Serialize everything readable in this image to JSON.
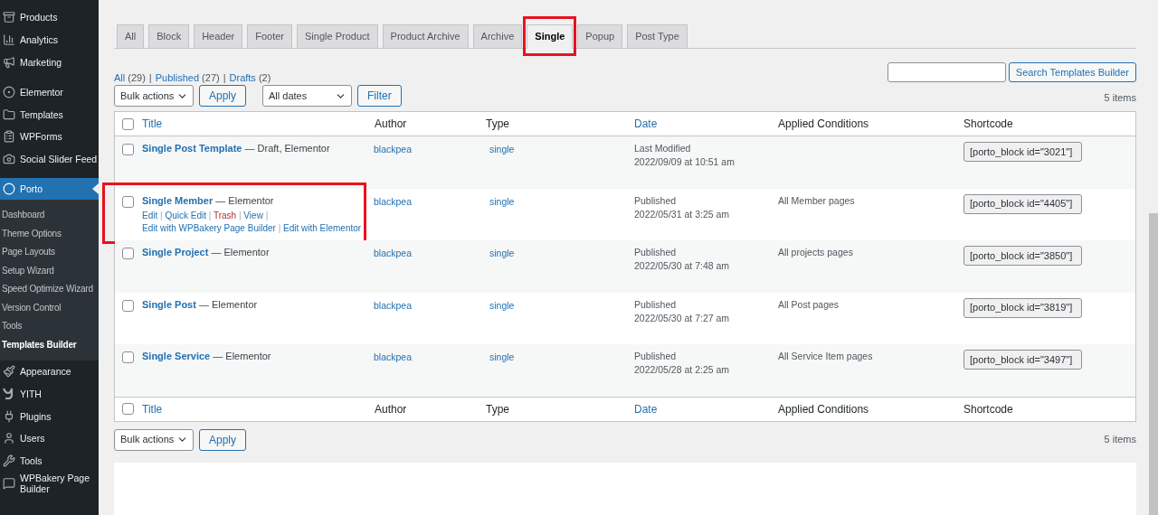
{
  "sidebar": {
    "items": [
      {
        "label": "Products",
        "kind": "menu",
        "current": false
      },
      {
        "label": "Analytics",
        "kind": "menu",
        "current": false
      },
      {
        "label": "Marketing",
        "kind": "menu",
        "current": false
      },
      {
        "label": "Elementor",
        "kind": "menu",
        "current": false
      },
      {
        "label": "Templates",
        "kind": "menu",
        "current": false
      },
      {
        "label": "WPForms",
        "kind": "menu",
        "current": false
      },
      {
        "label": "Social Slider Feed",
        "kind": "menu",
        "current": false
      },
      {
        "label": "Porto",
        "kind": "menu",
        "current": true
      },
      {
        "label": "Dashboard",
        "kind": "submenu",
        "current": false
      },
      {
        "label": "Theme Options",
        "kind": "submenu",
        "current": false
      },
      {
        "label": "Page Layouts",
        "kind": "submenu",
        "current": false
      },
      {
        "label": "Setup Wizard",
        "kind": "submenu",
        "current": false
      },
      {
        "label": "Speed Optimize Wizard",
        "kind": "submenu",
        "current": false
      },
      {
        "label": "Version Control",
        "kind": "submenu",
        "current": false
      },
      {
        "label": "Tools",
        "kind": "submenu",
        "current": false
      },
      {
        "label": "Templates Builder",
        "kind": "submenu",
        "current": true
      },
      {
        "label": "Appearance",
        "kind": "menu",
        "current": false
      },
      {
        "label": "YITH",
        "kind": "menu",
        "current": false
      },
      {
        "label": "Plugins",
        "kind": "menu",
        "current": false
      },
      {
        "label": "Users",
        "kind": "menu",
        "current": false
      },
      {
        "label": "Tools",
        "kind": "menu",
        "current": false
      },
      {
        "label": "WPBakery Page Builder",
        "kind": "menu",
        "current": false
      }
    ]
  },
  "tabs": [
    {
      "label": "All",
      "selected": false,
      "highlighted": false
    },
    {
      "label": "Block",
      "selected": false,
      "highlighted": false
    },
    {
      "label": "Header",
      "selected": false,
      "highlighted": false
    },
    {
      "label": "Footer",
      "selected": false,
      "highlighted": false
    },
    {
      "label": "Single Product",
      "selected": false,
      "highlighted": false
    },
    {
      "label": "Product Archive",
      "selected": false,
      "highlighted": false
    },
    {
      "label": "Archive",
      "selected": false,
      "highlighted": false
    },
    {
      "label": "Single",
      "selected": true,
      "highlighted": true
    },
    {
      "label": "Popup",
      "selected": false,
      "highlighted": false
    },
    {
      "label": "Post Type",
      "selected": false,
      "highlighted": false
    }
  ],
  "filter_separator": "|",
  "filters": [
    {
      "label": "All",
      "count": "(29)"
    },
    {
      "label": "Published",
      "count": "(27)"
    },
    {
      "label": "Drafts",
      "count": "(2)"
    }
  ],
  "search": {
    "button": "Search Templates Builder"
  },
  "top_actions": {
    "bulk": "Bulk actions",
    "apply": "Apply",
    "dates": "All dates",
    "filter": "Filter",
    "count": "5 items"
  },
  "bottom_actions": {
    "bulk": "Bulk actions",
    "apply": "Apply",
    "count": "5 items"
  },
  "table": {
    "header_checked": false,
    "footer_checked": false,
    "action_separator": "|",
    "footer_columns": [
      {
        "label": "Title",
        "sortable": true
      },
      {
        "label": "Author",
        "sortable": false
      },
      {
        "label": "Type",
        "sortable": false
      },
      {
        "label": "Date",
        "sortable": true
      },
      {
        "label": "Applied Conditions",
        "sortable": false
      },
      {
        "label": "Shortcode",
        "sortable": false
      }
    ],
    "columns": [
      {
        "label": "Title",
        "sortable": true
      },
      {
        "label": "Author",
        "sortable": false
      },
      {
        "label": "Type",
        "sortable": false
      },
      {
        "label": "Date",
        "sortable": true
      },
      {
        "label": "Applied Conditions",
        "sortable": false
      },
      {
        "label": "Shortcode",
        "sortable": false
      }
    ],
    "rows": [
      {
        "title": "Single Post Template",
        "suffix": "— Draft, Elementor",
        "author": "blackpea",
        "type": "single",
        "status": "Last Modified",
        "date": "2022/09/09 at 10:51 am",
        "conditions": "",
        "shortcode": "[porto_block id=\"3021\"]",
        "checked": false,
        "highlighted": false,
        "actions": []
      },
      {
        "title": "Single Member",
        "suffix": "— Elementor",
        "author": "blackpea",
        "type": "single",
        "status": "Published",
        "date": "2022/05/31 at 3:25 am",
        "conditions": "All Member pages",
        "shortcode": "[porto_block id=\"4405\"]",
        "checked": false,
        "highlighted": true,
        "actions": [
          {
            "label": "Edit",
            "kind": "link"
          },
          {
            "label": "Quick Edit",
            "kind": "link"
          },
          {
            "label": "Trash",
            "kind": "delete"
          },
          {
            "label": "View",
            "kind": "link"
          },
          {
            "label": "Edit with WPBakery Page Builder",
            "kind": "link"
          },
          {
            "label": "Edit with Elementor",
            "kind": "link"
          }
        ]
      },
      {
        "title": "Single Project",
        "suffix": "— Elementor",
        "author": "blackpea",
        "type": "single",
        "status": "Published",
        "date": "2022/05/30 at 7:48 am",
        "conditions": "All projects pages",
        "shortcode": "[porto_block id=\"3850\"]",
        "checked": false,
        "highlighted": false,
        "actions": []
      },
      {
        "title": "Single Post",
        "suffix": "— Elementor",
        "author": "blackpea",
        "type": "single",
        "status": "Published",
        "date": "2022/05/30 at 7:27 am",
        "conditions": "All Post pages",
        "shortcode": "[porto_block id=\"3819\"]",
        "checked": false,
        "highlighted": false,
        "actions": []
      },
      {
        "title": "Single Service",
        "suffix": "— Elementor",
        "author": "blackpea",
        "type": "single",
        "status": "Published",
        "date": "2022/05/28 at 2:25 am",
        "conditions": "All Service Item pages",
        "shortcode": "[porto_block id=\"3497\"]",
        "checked": false,
        "highlighted": false,
        "actions": []
      }
    ]
  }
}
